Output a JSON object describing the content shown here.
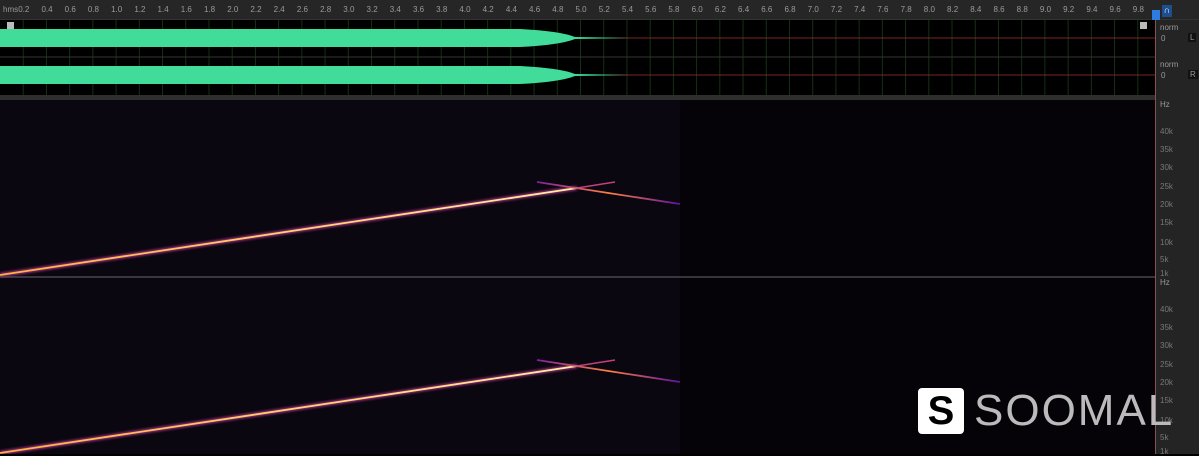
{
  "ruler": {
    "unit": "hms",
    "ticks": [
      "0.2",
      "0.4",
      "0.6",
      "0.8",
      "1.0",
      "1.2",
      "1.4",
      "1.6",
      "1.8",
      "2.0",
      "2.2",
      "2.4",
      "2.6",
      "2.8",
      "3.0",
      "3.2",
      "3.4",
      "3.6",
      "3.8",
      "4.0",
      "4.2",
      "4.4",
      "4.6",
      "4.8",
      "5.0",
      "5.2",
      "5.4",
      "5.6",
      "5.8",
      "6.0",
      "6.2",
      "6.4",
      "6.6",
      "6.8",
      "7.0",
      "7.2",
      "7.4",
      "7.6",
      "7.8",
      "8.0",
      "8.2",
      "8.4",
      "8.6",
      "8.8",
      "9.0",
      "9.2",
      "9.4",
      "9.6",
      "9.8"
    ]
  },
  "channels": [
    {
      "scale": "norm",
      "zero": "0",
      "button": "L"
    },
    {
      "scale": "norm",
      "zero": "0",
      "button": "R"
    }
  ],
  "spectrogram": {
    "unit": "Hz",
    "labels": [
      "40k",
      "35k",
      "30k",
      "25k",
      "20k",
      "15k",
      "10k",
      "5k",
      "1k"
    ]
  },
  "colors": {
    "waveform": "#41dc9a",
    "accent": "#2e7ce0"
  },
  "logo": {
    "text": "SOOMAL",
    "mark": "S"
  }
}
